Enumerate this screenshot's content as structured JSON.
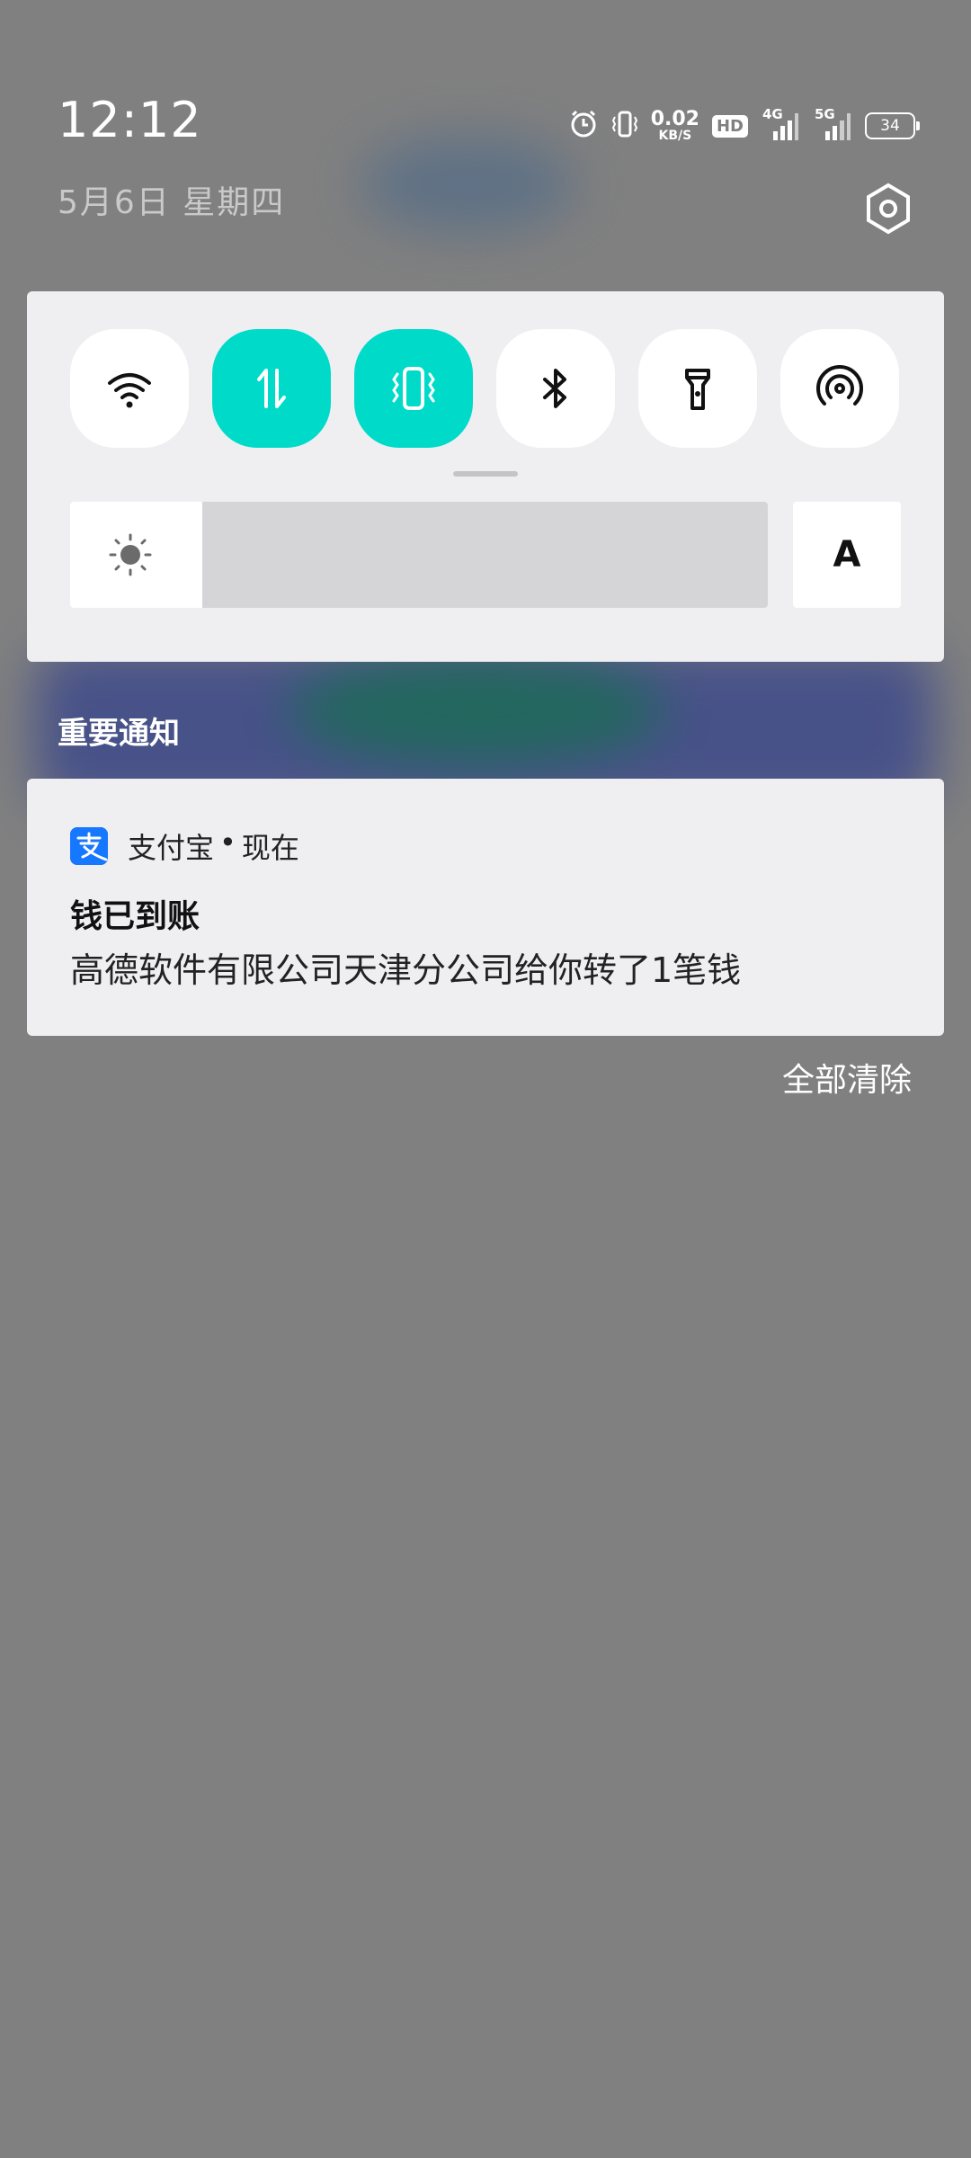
{
  "status_bar": {
    "time": "12:12",
    "date": "5月6日  星期四",
    "net_speed_value": "0.02",
    "net_speed_unit": "KB/S",
    "hd_badge": "HD",
    "sim1_network": "4G",
    "sim2_network": "5G",
    "battery_level": "34"
  },
  "quick_settings": {
    "tiles": [
      {
        "name": "wifi",
        "icon": "wifi-icon",
        "active": false
      },
      {
        "name": "mobile-data",
        "icon": "data-arrows-icon",
        "active": true
      },
      {
        "name": "vibrate",
        "icon": "vibrate-icon",
        "active": true
      },
      {
        "name": "bluetooth",
        "icon": "bluetooth-icon",
        "active": false
      },
      {
        "name": "flashlight",
        "icon": "flashlight-icon",
        "active": false
      },
      {
        "name": "hotspot",
        "icon": "hotspot-icon",
        "active": false
      }
    ],
    "brightness_level": 0.19,
    "auto_brightness_label": "A",
    "accent_color": "#00dbc9"
  },
  "notifications": {
    "section_title": "重要通知",
    "items": [
      {
        "app_name": "支付宝",
        "separator": "•",
        "time": "现在",
        "title": "钱已到账",
        "body": "高德软件有限公司天津分公司给你转了1笔钱",
        "app_icon_color": "#1677ff"
      }
    ],
    "clear_all_label": "全部清除"
  }
}
